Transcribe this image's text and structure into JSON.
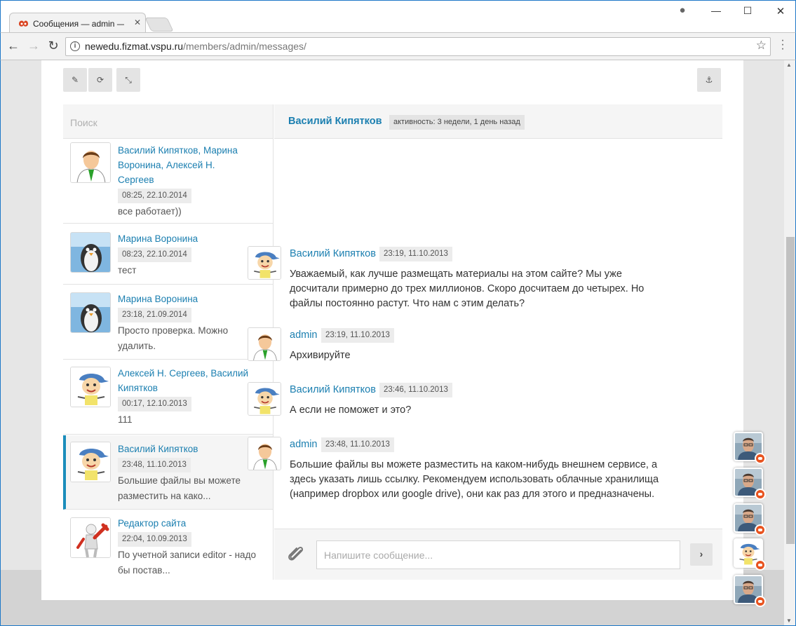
{
  "browser": {
    "tab_title": "Сообщения — admin —",
    "tab_close": "✕",
    "url_host": "newedu.fizmat.vspu.ru",
    "url_path": "/members/admin/messages/",
    "icons": {
      "back": "arrow-left-icon",
      "forward": "arrow-right-icon",
      "reload": "reload-icon",
      "info": "info-icon",
      "bookmark": "star-icon",
      "menu": "three-dots-icon",
      "profile": "user-icon"
    }
  },
  "toolbar": {
    "buttons": [
      {
        "icon": "pencil-icon",
        "glyph": "✎"
      },
      {
        "icon": "refresh-icon",
        "glyph": "⟳"
      },
      {
        "icon": "collapse-icon",
        "glyph": "⤡"
      },
      {
        "icon": "anchor-icon",
        "glyph": "⚓"
      }
    ]
  },
  "search": {
    "placeholder": "Поиск"
  },
  "conversations": [
    {
      "names": "Василий Кипятков, Марина Воронина, Алексей Н. Сергеев",
      "time": "08:25, 22.10.2014",
      "preview": "все работает))",
      "avatar": "default-man-avatar",
      "active": false
    },
    {
      "names": "Марина Воронина",
      "time": "08:23, 22.10.2014",
      "preview": "тест",
      "avatar": "penguin-avatar",
      "active": false
    },
    {
      "names": "Марина Воронина",
      "time": "23:18, 21.09.2014",
      "preview": "Просто проверка. Можно удалить.",
      "avatar": "penguin-avatar",
      "active": false
    },
    {
      "names": "Алексей Н. Сергеев, Василий Кипятков",
      "time": "00:17, 12.10.2013",
      "preview": "111",
      "avatar": "cartoon-boy-avatar",
      "active": false
    },
    {
      "names": "Василий Кипятков",
      "time": "23:48, 11.10.2013",
      "preview": "Большие файлы вы можете разместить на како...",
      "avatar": "cartoon-boy-avatar",
      "active": true
    },
    {
      "names": "Редактор сайта",
      "time": "22:04, 10.09.2013",
      "preview": "По учетной записи editor - надо бы постав...",
      "avatar": "wrench-man-avatar",
      "active": false
    }
  ],
  "thread": {
    "name": "Василий Кипятков",
    "activity": "активность: 3 недели, 1 день назад",
    "messages": [
      {
        "author": "Василий Кипятков",
        "time": "23:19, 11.10.2013",
        "text": "Уважаемый, как лучше размещать материалы на этом сайте? Мы уже досчитали примерно до трех миллионов. Скоро досчитаем до четырех. Но файлы постоянно растут. Что нам с этим делать?",
        "avatar": "cartoon-boy-avatar"
      },
      {
        "author": "admin",
        "time": "23:19, 11.10.2013",
        "text": "Архивируйте",
        "avatar": "default-man-avatar"
      },
      {
        "author": "Василий Кипятков",
        "time": "23:46, 11.10.2013",
        "text": "А если не поможет и это?",
        "avatar": "cartoon-boy-avatar"
      },
      {
        "author": "admin",
        "time": "23:48, 11.10.2013",
        "text": "Большие файлы вы можете разместить на каком-нибудь внешнем сервисе, а здесь указать лишь ссылку. Рекомендуем использовать облачные хранилища (например dropbox или google drive), они как раз для этого и предназначены.",
        "avatar": "default-man-avatar"
      }
    ]
  },
  "compose": {
    "placeholder": "Напишите сообщение...",
    "attach_icon": "paperclip-icon",
    "send_glyph": "›"
  },
  "chatheads": [
    {
      "avatar": "photo-man-avatar",
      "badge_icon": "chat-bubble-icon"
    },
    {
      "avatar": "photo-man-avatar",
      "badge_icon": "chat-bubble-icon"
    },
    {
      "avatar": "photo-man-avatar",
      "badge_icon": "chat-bubble-icon"
    },
    {
      "avatar": "cartoon-boy-avatar",
      "badge_icon": "chat-bubble-icon"
    },
    {
      "avatar": "photo-man-avatar",
      "badge_icon": "chat-bubble-icon"
    }
  ],
  "colors": {
    "link": "#1b7fb0",
    "active_bar": "#1b8dbb",
    "badge": "#e8531f"
  }
}
